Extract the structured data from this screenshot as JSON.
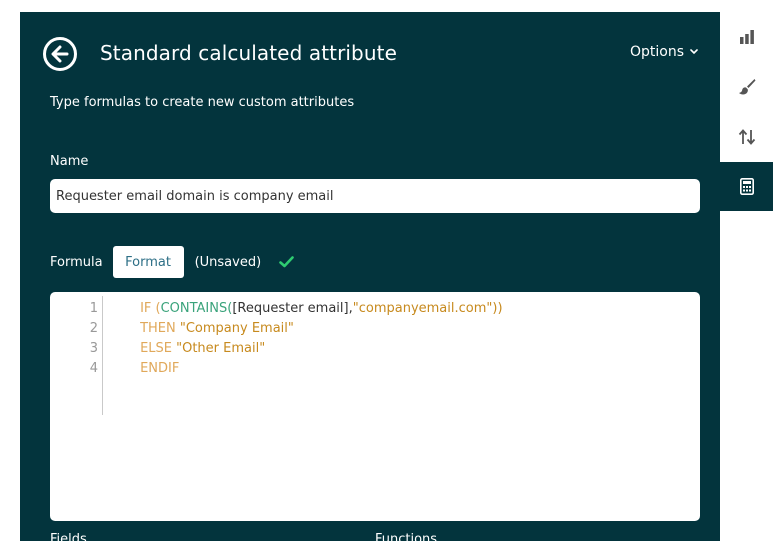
{
  "header": {
    "title": "Standard calculated attribute",
    "options_label": "Options"
  },
  "subtitle": "Type formulas to create new custom attributes",
  "name": {
    "label": "Name",
    "value": "Requester email domain is company email"
  },
  "formula": {
    "label": "Formula",
    "format_label": "Format",
    "status": "(Unsaved)"
  },
  "editor": {
    "lines": [
      {
        "number": "1",
        "parts": [
          "IF (",
          "CONTAINS(",
          "[Requester email],",
          "\"companyemail.com\"))"
        ]
      },
      {
        "number": "2",
        "parts": [
          "THEN ",
          "\"Company Email\""
        ]
      },
      {
        "number": "3",
        "parts": [
          "ELSE ",
          "\"Other Email\""
        ]
      },
      {
        "number": "4",
        "parts": [
          "ENDIF"
        ]
      }
    ]
  },
  "bottom": {
    "fields_label": "Fields",
    "functions_label": "Functions"
  },
  "colors": {
    "panel_bg": "#03343d",
    "keyword": "#e0a85a",
    "function": "#3aa37b",
    "string": "#c78a1e",
    "check": "#2ecc71",
    "format_text": "#2d6f86"
  },
  "sidebar": {
    "items": [
      {
        "icon": "bar-chart-icon"
      },
      {
        "icon": "paintbrush-icon"
      },
      {
        "icon": "sort-arrows-icon"
      },
      {
        "icon": "calculator-icon",
        "active": true
      }
    ]
  }
}
